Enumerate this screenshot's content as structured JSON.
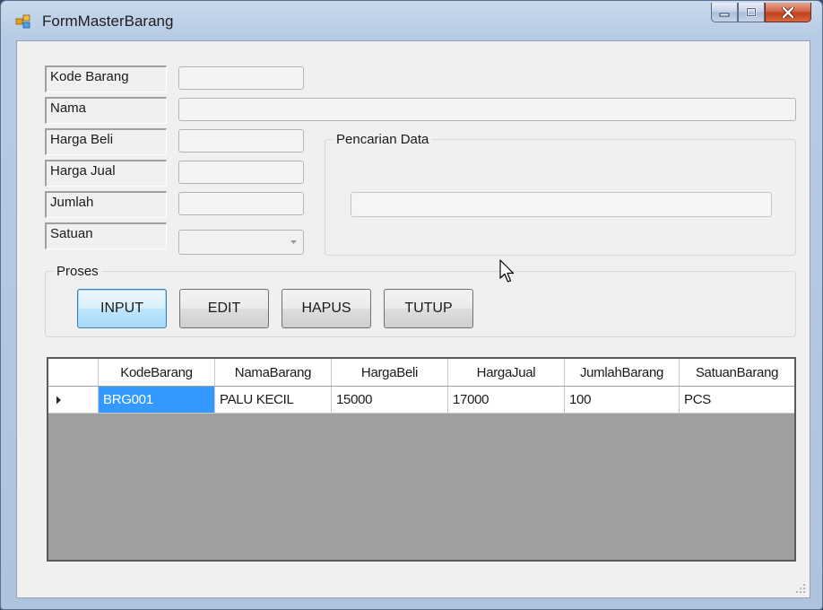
{
  "window": {
    "title": "FormMasterBarang"
  },
  "form": {
    "fields": [
      {
        "label": "Kode Barang",
        "value": ""
      },
      {
        "label": "Nama",
        "value": ""
      },
      {
        "label": "Harga Beli",
        "value": ""
      },
      {
        "label": "Harga Jual",
        "value": ""
      },
      {
        "label": "Jumlah",
        "value": ""
      },
      {
        "label": "Satuan",
        "value": ""
      }
    ]
  },
  "search": {
    "title": "Pencarian Data",
    "value": ""
  },
  "proses": {
    "title": "Proses",
    "buttons": [
      "INPUT",
      "EDIT",
      "HAPUS",
      "TUTUP"
    ]
  },
  "grid": {
    "columns": [
      "KodeBarang",
      "NamaBarang",
      "HargaBeli",
      "HargaJual",
      "JumlahBarang",
      "SatuanBarang"
    ],
    "rows": [
      [
        "BRG001",
        "PALU KECIL",
        "15000",
        "17000",
        "100",
        "PCS"
      ]
    ],
    "selected_color": "#3399ff"
  },
  "icons": {
    "app": "form-icon",
    "minimize": "minimize-icon",
    "maximize": "maximize-icon",
    "close": "close-icon",
    "row_pointer": "row-pointer-icon",
    "dropdown": "chevron-down-icon",
    "cursor": "mouse-cursor-icon"
  }
}
